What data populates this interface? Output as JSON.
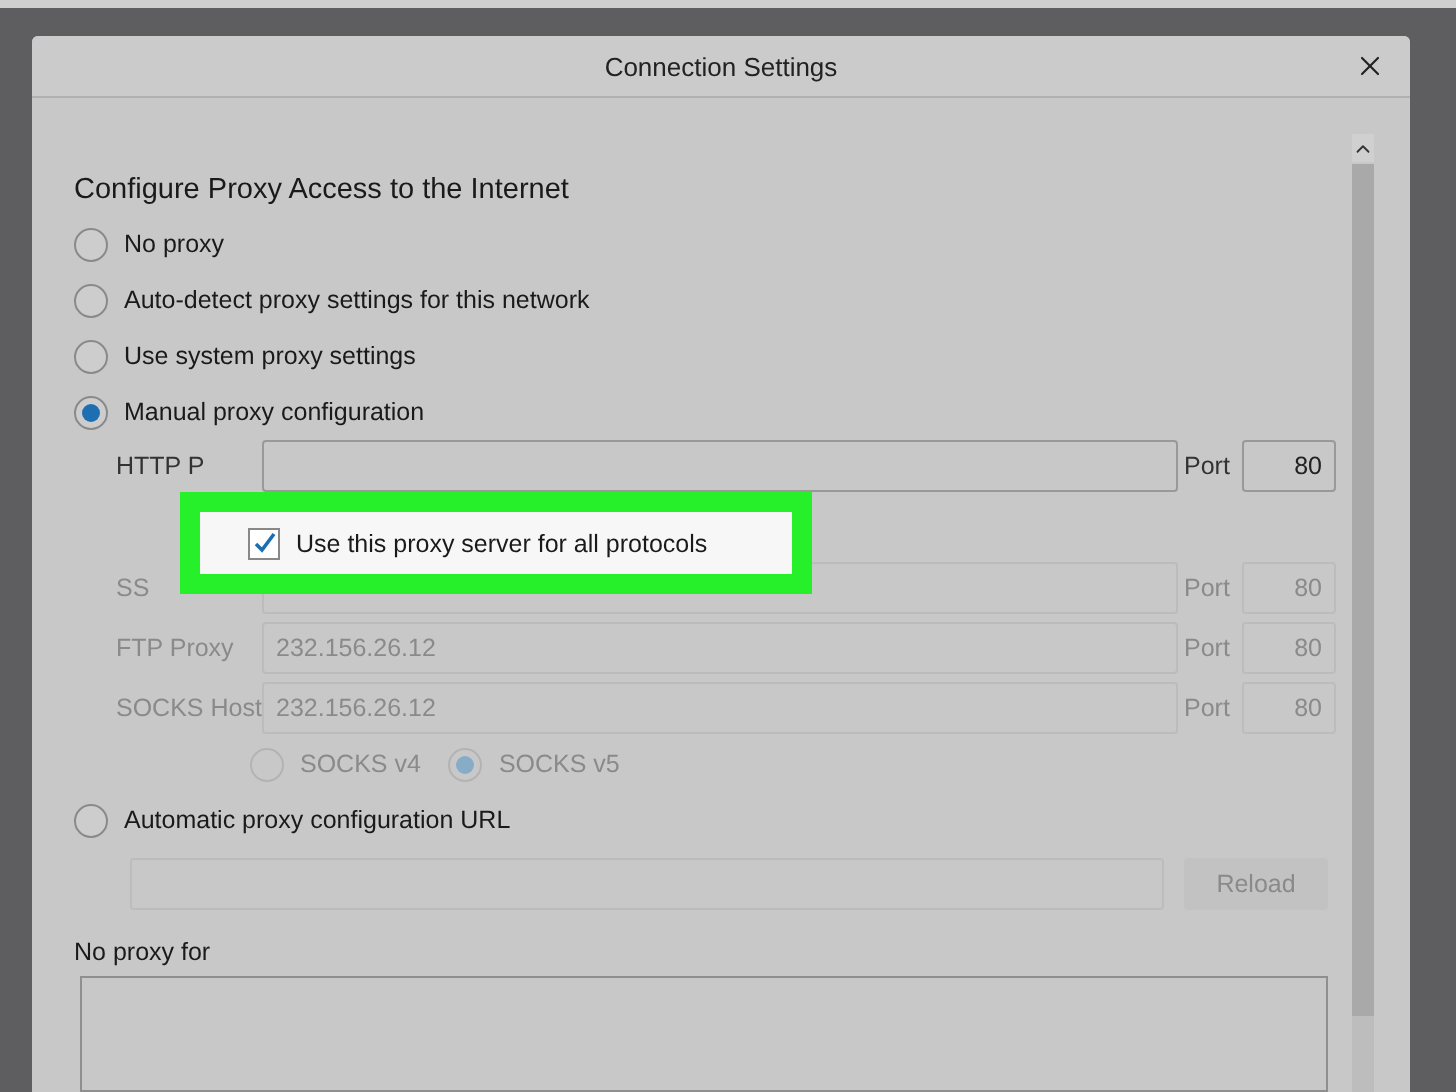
{
  "dialog": {
    "title": "Connection Settings"
  },
  "section_title": "Configure Proxy Access to the Internet",
  "proxy_modes": [
    {
      "label": "No proxy",
      "selected": false
    },
    {
      "label": "Auto-detect proxy settings for this network",
      "selected": false
    },
    {
      "label": "Use system proxy settings",
      "selected": false
    },
    {
      "label": "Manual proxy configuration",
      "selected": true
    }
  ],
  "manual_proxies": [
    {
      "label": "HTTP P",
      "port_label": "Port",
      "port": "80",
      "disabled": false
    },
    {
      "label": "SS",
      "port_label": "Port",
      "port": "80",
      "disabled": true
    },
    {
      "label": "FTP Proxy",
      "value": "232.156.26.12",
      "port_label": "Port",
      "port": "80",
      "disabled": true
    },
    {
      "label": "SOCKS Host",
      "value": "232.156.26.12",
      "port_label": "Port",
      "port": "80",
      "disabled": true
    }
  ],
  "socks_versions": [
    {
      "label": "SOCKS v4",
      "selected": false,
      "disabled": true
    },
    {
      "label": "SOCKS v5",
      "selected": true,
      "disabled": true
    }
  ],
  "auto_proxy": {
    "label": "Automatic proxy configuration URL",
    "selected": false,
    "button": {
      "label": "Reload",
      "disabled": true
    }
  },
  "no_proxy_for": {
    "label": "No proxy for"
  },
  "callout": {
    "checkbox": {
      "label": "Use this proxy server for all protocols",
      "checked": true
    }
  }
}
